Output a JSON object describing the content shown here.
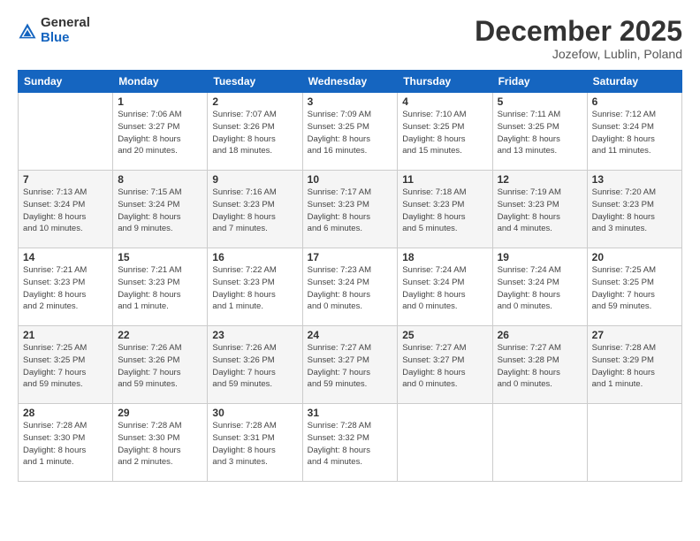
{
  "header": {
    "logo_general": "General",
    "logo_blue": "Blue",
    "month_title": "December 2025",
    "location": "Jozefow, Lublin, Poland"
  },
  "weekdays": [
    "Sunday",
    "Monday",
    "Tuesday",
    "Wednesday",
    "Thursday",
    "Friday",
    "Saturday"
  ],
  "weeks": [
    [
      {
        "day": "",
        "info": ""
      },
      {
        "day": "1",
        "info": "Sunrise: 7:06 AM\nSunset: 3:27 PM\nDaylight: 8 hours\nand 20 minutes."
      },
      {
        "day": "2",
        "info": "Sunrise: 7:07 AM\nSunset: 3:26 PM\nDaylight: 8 hours\nand 18 minutes."
      },
      {
        "day": "3",
        "info": "Sunrise: 7:09 AM\nSunset: 3:25 PM\nDaylight: 8 hours\nand 16 minutes."
      },
      {
        "day": "4",
        "info": "Sunrise: 7:10 AM\nSunset: 3:25 PM\nDaylight: 8 hours\nand 15 minutes."
      },
      {
        "day": "5",
        "info": "Sunrise: 7:11 AM\nSunset: 3:25 PM\nDaylight: 8 hours\nand 13 minutes."
      },
      {
        "day": "6",
        "info": "Sunrise: 7:12 AM\nSunset: 3:24 PM\nDaylight: 8 hours\nand 11 minutes."
      }
    ],
    [
      {
        "day": "7",
        "info": "Sunrise: 7:13 AM\nSunset: 3:24 PM\nDaylight: 8 hours\nand 10 minutes."
      },
      {
        "day": "8",
        "info": "Sunrise: 7:15 AM\nSunset: 3:24 PM\nDaylight: 8 hours\nand 9 minutes."
      },
      {
        "day": "9",
        "info": "Sunrise: 7:16 AM\nSunset: 3:23 PM\nDaylight: 8 hours\nand 7 minutes."
      },
      {
        "day": "10",
        "info": "Sunrise: 7:17 AM\nSunset: 3:23 PM\nDaylight: 8 hours\nand 6 minutes."
      },
      {
        "day": "11",
        "info": "Sunrise: 7:18 AM\nSunset: 3:23 PM\nDaylight: 8 hours\nand 5 minutes."
      },
      {
        "day": "12",
        "info": "Sunrise: 7:19 AM\nSunset: 3:23 PM\nDaylight: 8 hours\nand 4 minutes."
      },
      {
        "day": "13",
        "info": "Sunrise: 7:20 AM\nSunset: 3:23 PM\nDaylight: 8 hours\nand 3 minutes."
      }
    ],
    [
      {
        "day": "14",
        "info": "Sunrise: 7:21 AM\nSunset: 3:23 PM\nDaylight: 8 hours\nand 2 minutes."
      },
      {
        "day": "15",
        "info": "Sunrise: 7:21 AM\nSunset: 3:23 PM\nDaylight: 8 hours\nand 1 minute."
      },
      {
        "day": "16",
        "info": "Sunrise: 7:22 AM\nSunset: 3:23 PM\nDaylight: 8 hours\nand 1 minute."
      },
      {
        "day": "17",
        "info": "Sunrise: 7:23 AM\nSunset: 3:24 PM\nDaylight: 8 hours\nand 0 minutes."
      },
      {
        "day": "18",
        "info": "Sunrise: 7:24 AM\nSunset: 3:24 PM\nDaylight: 8 hours\nand 0 minutes."
      },
      {
        "day": "19",
        "info": "Sunrise: 7:24 AM\nSunset: 3:24 PM\nDaylight: 8 hours\nand 0 minutes."
      },
      {
        "day": "20",
        "info": "Sunrise: 7:25 AM\nSunset: 3:25 PM\nDaylight: 7 hours\nand 59 minutes."
      }
    ],
    [
      {
        "day": "21",
        "info": "Sunrise: 7:25 AM\nSunset: 3:25 PM\nDaylight: 7 hours\nand 59 minutes."
      },
      {
        "day": "22",
        "info": "Sunrise: 7:26 AM\nSunset: 3:26 PM\nDaylight: 7 hours\nand 59 minutes."
      },
      {
        "day": "23",
        "info": "Sunrise: 7:26 AM\nSunset: 3:26 PM\nDaylight: 7 hours\nand 59 minutes."
      },
      {
        "day": "24",
        "info": "Sunrise: 7:27 AM\nSunset: 3:27 PM\nDaylight: 7 hours\nand 59 minutes."
      },
      {
        "day": "25",
        "info": "Sunrise: 7:27 AM\nSunset: 3:27 PM\nDaylight: 8 hours\nand 0 minutes."
      },
      {
        "day": "26",
        "info": "Sunrise: 7:27 AM\nSunset: 3:28 PM\nDaylight: 8 hours\nand 0 minutes."
      },
      {
        "day": "27",
        "info": "Sunrise: 7:28 AM\nSunset: 3:29 PM\nDaylight: 8 hours\nand 1 minute."
      }
    ],
    [
      {
        "day": "28",
        "info": "Sunrise: 7:28 AM\nSunset: 3:30 PM\nDaylight: 8 hours\nand 1 minute."
      },
      {
        "day": "29",
        "info": "Sunrise: 7:28 AM\nSunset: 3:30 PM\nDaylight: 8 hours\nand 2 minutes."
      },
      {
        "day": "30",
        "info": "Sunrise: 7:28 AM\nSunset: 3:31 PM\nDaylight: 8 hours\nand 3 minutes."
      },
      {
        "day": "31",
        "info": "Sunrise: 7:28 AM\nSunset: 3:32 PM\nDaylight: 8 hours\nand 4 minutes."
      },
      {
        "day": "",
        "info": ""
      },
      {
        "day": "",
        "info": ""
      },
      {
        "day": "",
        "info": ""
      }
    ]
  ]
}
